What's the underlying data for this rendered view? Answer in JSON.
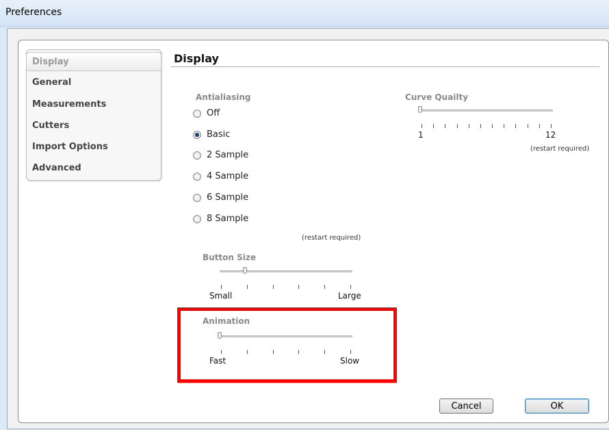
{
  "window": {
    "title": "Preferences"
  },
  "sidebar": {
    "items": [
      {
        "label": "Display",
        "selected": true
      },
      {
        "label": "General"
      },
      {
        "label": "Measurements"
      },
      {
        "label": "Cutters"
      },
      {
        "label": "Import Options"
      },
      {
        "label": "Advanced"
      }
    ]
  },
  "display": {
    "section_title": "Display",
    "antialiasing": {
      "label": "Antialiasing",
      "options": [
        "Off",
        "Basic",
        "2 Sample",
        "4 Sample",
        "6 Sample",
        "8 Sample"
      ],
      "selected": "Basic",
      "note": "(restart required)"
    },
    "curve_quality": {
      "label": "Curve Quailty",
      "min_label": "1",
      "max_label": "12",
      "value": 1,
      "note": "(restart required)"
    },
    "button_size": {
      "label": "Button Size",
      "min_label": "Small",
      "max_label": "Large",
      "value": 1
    },
    "animation": {
      "label": "Animation",
      "min_label": "Fast",
      "max_label": "Slow",
      "value": 0
    }
  },
  "buttons": {
    "cancel": "Cancel",
    "ok": "OK"
  },
  "colors": {
    "highlight": "#ff0000"
  }
}
